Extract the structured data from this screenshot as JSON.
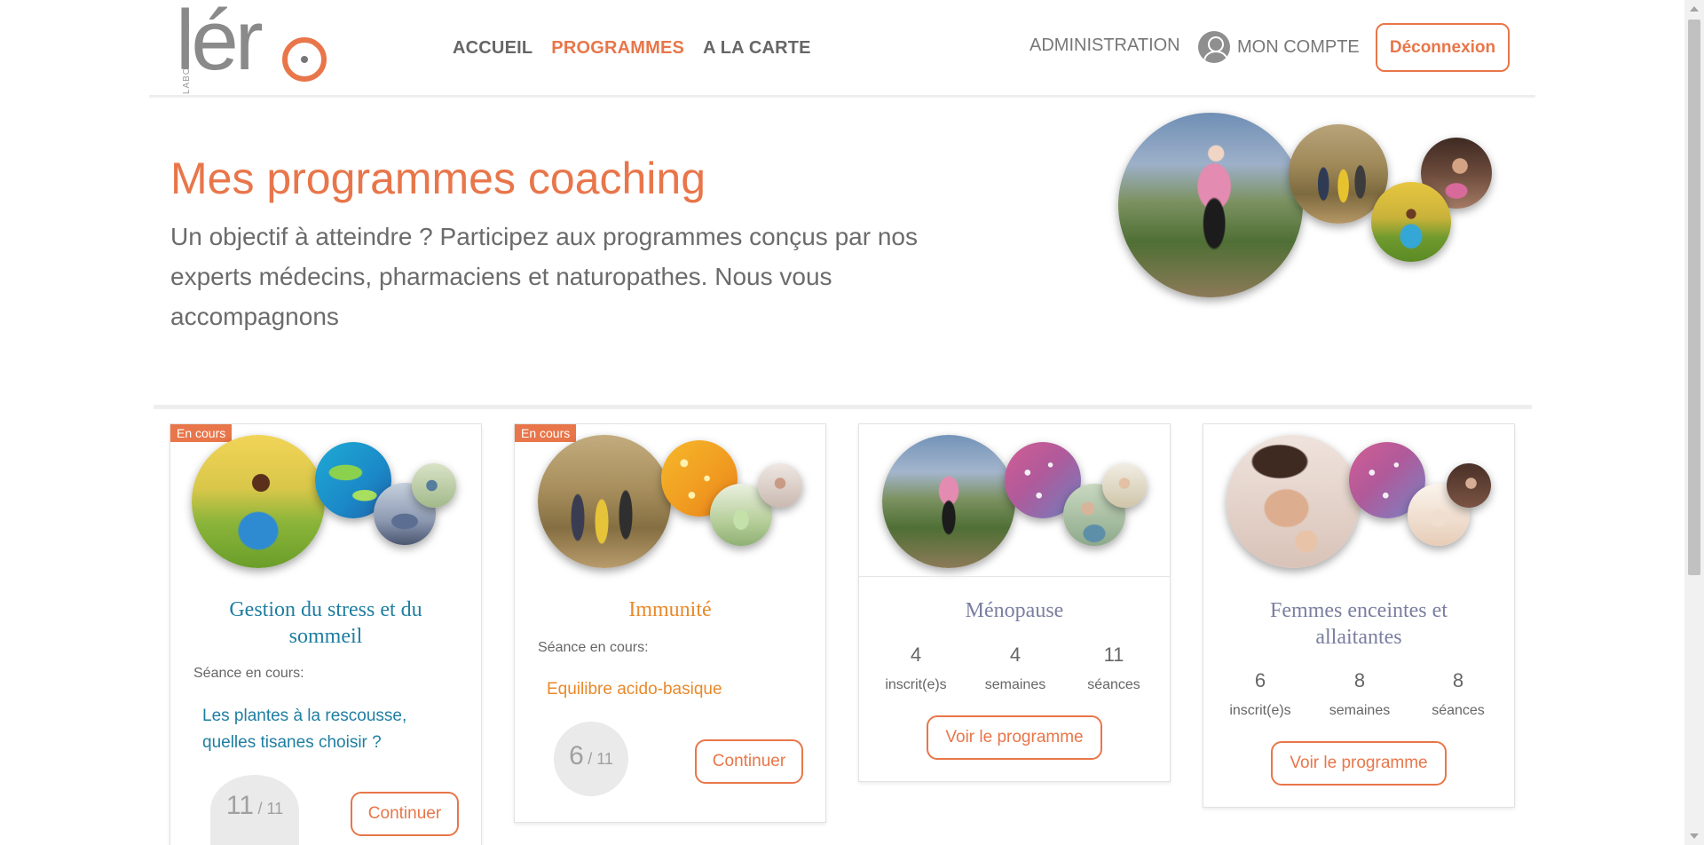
{
  "brand": {
    "logo_vertical": "LABORATOIRE",
    "logo_word": "lér"
  },
  "nav": {
    "home": "ACCUEIL",
    "programs": "PROGRAMMES",
    "menu": "A LA CARTE"
  },
  "header": {
    "admin": "ADMINISTRATION",
    "account": "MON COMPTE",
    "logout": "Déconnexion"
  },
  "hero": {
    "title": "Mes programmes coaching",
    "text": "Un objectif à atteindre ? Participez aux programmes conçus par nos experts médecins, pharmaciens et naturopathes. Nous vous accompagnons"
  },
  "cards": [
    {
      "badge": "En cours",
      "title": "Gestion du stress et du sommeil",
      "session_label": "Séance en cours:",
      "session": "Les plantes à la rescousse, quelles tisanes choisir ?",
      "progress_current": "11",
      "progress_total": "/ 11",
      "button": "Continuer"
    },
    {
      "badge": "En cours",
      "title": "Immunité",
      "session_label": "Séance en cours:",
      "session": "Equilibre acido-basique",
      "progress_current": "6",
      "progress_total": "/ 11",
      "button": "Continuer"
    },
    {
      "title": "Ménopause",
      "stats": [
        {
          "value": "4",
          "label": "inscrit(e)s"
        },
        {
          "value": "4",
          "label": "semaines"
        },
        {
          "value": "11",
          "label": "séances"
        }
      ],
      "button": "Voir le programme"
    },
    {
      "title": "Femmes enceintes et allaitantes",
      "stats": [
        {
          "value": "6",
          "label": "inscrit(e)s"
        },
        {
          "value": "8",
          "label": "semaines"
        },
        {
          "value": "8",
          "label": "séances"
        }
      ],
      "button": "Voir le programme"
    }
  ],
  "colors": {
    "accent": "#e8764a",
    "stress_title": "#1f7ea1",
    "immunity_title": "#e8892b",
    "menopause_title": "#7a7fa0"
  }
}
